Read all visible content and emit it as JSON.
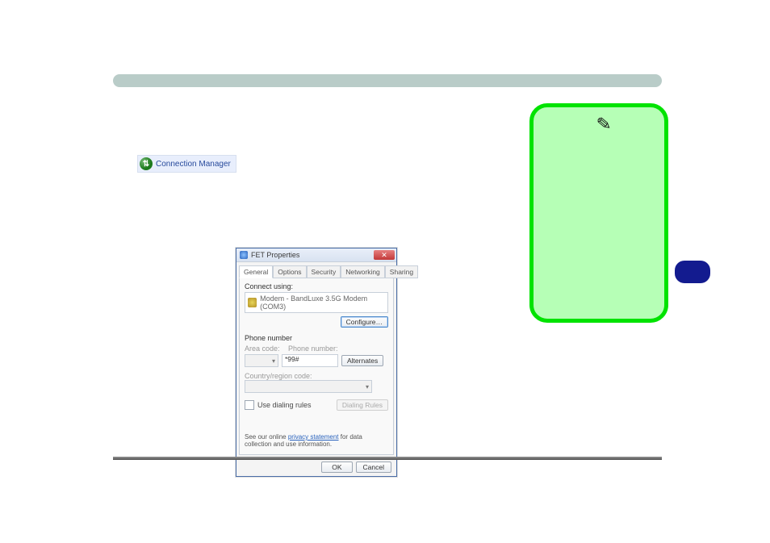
{
  "conn_mgr": {
    "label": "Connection Manager"
  },
  "note": {
    "icon": "✎"
  },
  "dialog": {
    "title": "FET Properties",
    "tabs": {
      "general": "General",
      "options": "Options",
      "security": "Security",
      "networking": "Networking",
      "sharing": "Sharing"
    },
    "connect_using_label": "Connect using:",
    "modem_name": "Modem - BandLuxe 3.5G Modem (COM3)",
    "configure_btn": "Configure…",
    "phone": {
      "section_label": "Phone number",
      "area_label": "Area code:",
      "area_value": "",
      "number_label": "Phone number:",
      "number_value": "*99#",
      "alternates_btn": "Alternates",
      "country_label": "Country/region code:",
      "country_value": "",
      "use_dialing_label": "Use dialing rules",
      "dialing_rules_btn": "Dialing Rules"
    },
    "privacy_text_a": "See our online ",
    "privacy_link": "privacy statement",
    "privacy_text_b": " for data collection and use information.",
    "ok_btn": "OK",
    "cancel_btn": "Cancel",
    "close_x": "✕"
  }
}
